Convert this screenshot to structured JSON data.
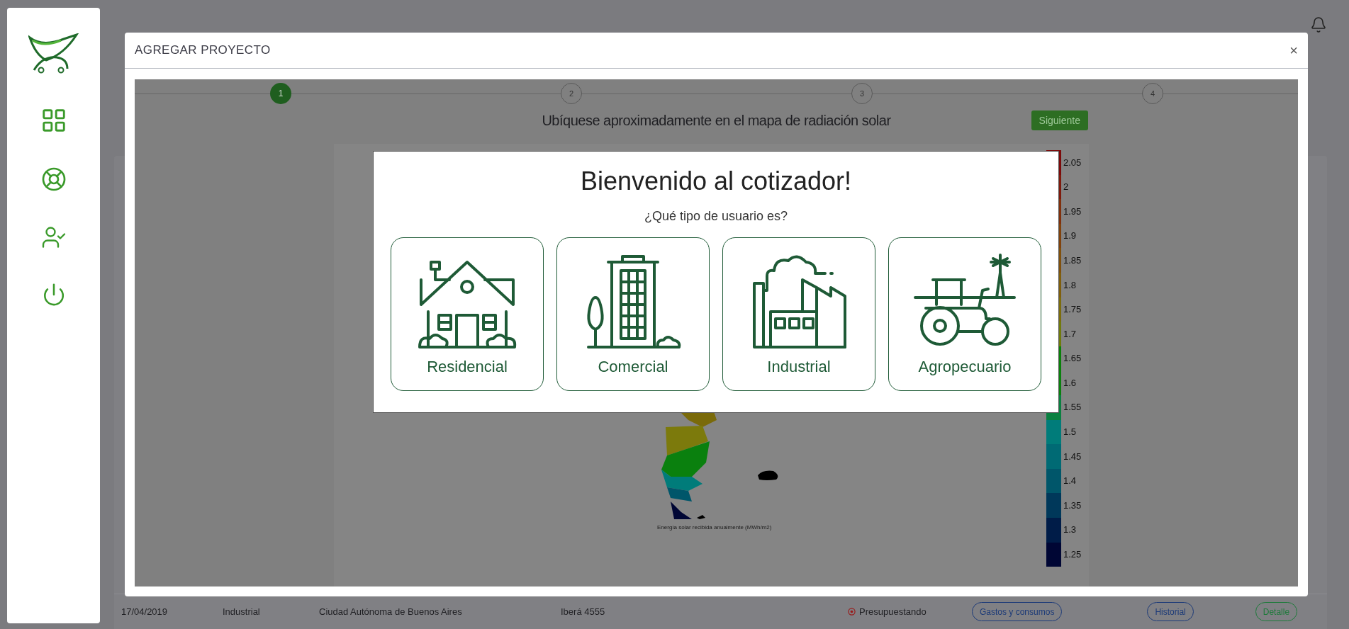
{
  "modal": {
    "title": "AGREGAR PROYECTO",
    "close": "×",
    "steps": [
      {
        "label": "1",
        "selected": true
      },
      {
        "label": "2",
        "selected": false
      },
      {
        "label": "3",
        "selected": false
      },
      {
        "label": "4",
        "selected": false
      }
    ],
    "heading": "Ubíquese aproximadamente en el mapa de radiación solar",
    "next_button": "Siguiente",
    "map": {
      "caption": "Energía solar recibida anualmente (MWh/m2)",
      "legend": [
        {
          "label": "2.05",
          "color": "#7c0a0a"
        },
        {
          "label": "2",
          "color": "#7e1a0c"
        },
        {
          "label": "1.95",
          "color": "#80300c"
        },
        {
          "label": "1.9",
          "color": "#80420c"
        },
        {
          "label": "1.85",
          "color": "#80500c"
        },
        {
          "label": "1.8",
          "color": "#7f5e0c"
        },
        {
          "label": "1.75",
          "color": "#7c6c0c"
        },
        {
          "label": "1.7",
          "color": "#707a0c"
        },
        {
          "label": "1.65",
          "color": "#0a800a"
        },
        {
          "label": "1.6",
          "color": "#0a800e"
        },
        {
          "label": "1.55",
          "color": "#0a8040"
        },
        {
          "label": "1.5",
          "color": "#007c7a"
        },
        {
          "label": "1.45",
          "color": "#006a74"
        },
        {
          "label": "1.4",
          "color": "#00566a"
        },
        {
          "label": "1.35",
          "color": "#00385a"
        },
        {
          "label": "1.3",
          "color": "#001c48"
        },
        {
          "label": "1.25",
          "color": "#000634"
        }
      ]
    }
  },
  "welcome": {
    "title": "Bienvenido al cotizador!",
    "question": "¿Qué tipo de usuario es?",
    "options": [
      {
        "label": "Residencial",
        "kind": "house"
      },
      {
        "label": "Comercial",
        "kind": "building"
      },
      {
        "label": "Industrial",
        "kind": "factory"
      },
      {
        "label": "Agropecuario",
        "kind": "tractor"
      }
    ]
  },
  "table_row": {
    "cells": [
      "17/04/2019",
      "Industrial",
      "Ciudad Autónoma de Buenos Aires",
      "Iberá 4555"
    ],
    "status": "Presupuestando",
    "buttons": [
      {
        "label": "Gastos y consumos",
        "color": "#1c3a78"
      },
      {
        "label": "Historial",
        "color": "#1c3a78"
      },
      {
        "label": "Detalle",
        "color": "#1d7a3a"
      }
    ]
  }
}
